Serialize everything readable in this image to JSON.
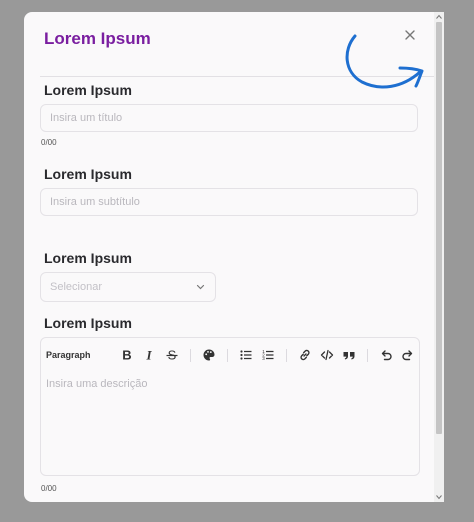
{
  "modal": {
    "title": "Lorem Ipsum",
    "close_icon": "close-icon"
  },
  "fields": {
    "title": {
      "label": "Lorem Ipsum",
      "placeholder": "Insira um título",
      "counter": "0/00"
    },
    "subtitle": {
      "label": "Lorem Ipsum",
      "placeholder": "Insira um subtítulo"
    },
    "select": {
      "label": "Lorem Ipsum",
      "placeholder": "Selecionar",
      "chevron_icon": "chevron-down-icon"
    },
    "description": {
      "label": "Lorem Ipsum",
      "placeholder": "Insira uma descrição",
      "counter": "0/00"
    }
  },
  "editor_toolbar": {
    "paragraph_label": "Paragraph",
    "icons": [
      "bold-icon",
      "italic-icon",
      "strikethrough-icon",
      "palette-icon",
      "bullet-list-icon",
      "ordered-list-icon",
      "link-icon",
      "code-icon",
      "quote-icon",
      "undo-icon",
      "redo-icon"
    ]
  },
  "colors": {
    "accent": "#7a1ea0",
    "annotation": "#1e6fd0",
    "backdrop": "#999999"
  }
}
